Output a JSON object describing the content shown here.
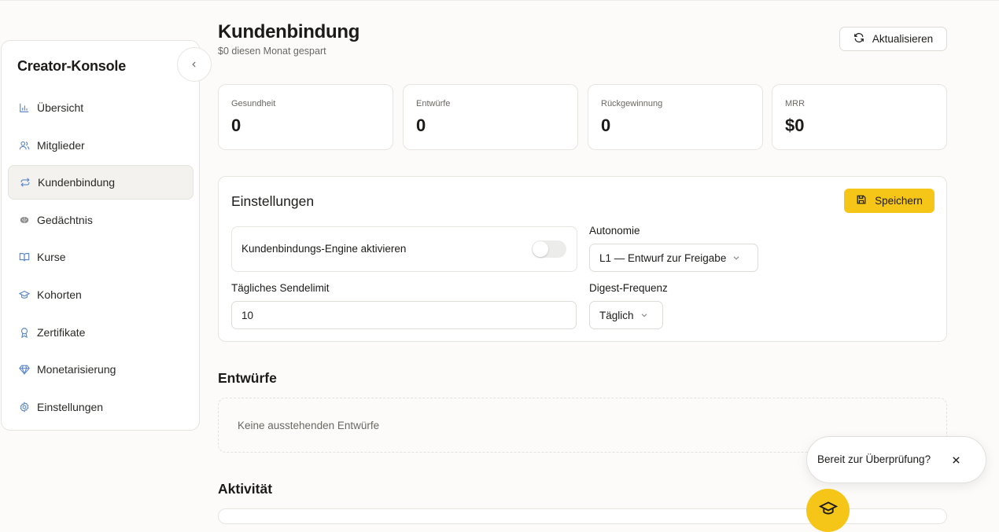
{
  "sidebar": {
    "title": "Creator-Konsole",
    "items": [
      {
        "label": "Übersicht",
        "icon": "bar-chart-icon"
      },
      {
        "label": "Mitglieder",
        "icon": "users-icon"
      },
      {
        "label": "Kundenbindung",
        "icon": "repeat-icon",
        "active": true
      },
      {
        "label": "Gedächtnis",
        "icon": "brain-icon"
      },
      {
        "label": "Kurse",
        "icon": "book-open-icon"
      },
      {
        "label": "Kohorten",
        "icon": "graduation-cap-icon"
      },
      {
        "label": "Zertifikate",
        "icon": "award-icon"
      },
      {
        "label": "Monetarisierung",
        "icon": "gem-icon"
      },
      {
        "label": "Einstellungen",
        "icon": "settings-icon"
      }
    ]
  },
  "header": {
    "title": "Kundenbindung",
    "subtitle": "$0 diesen Monat gespart",
    "refresh_label": "Aktualisieren"
  },
  "stats": [
    {
      "label": "Gesundheit",
      "value": "0"
    },
    {
      "label": "Entwürfe",
      "value": "0"
    },
    {
      "label": "Rückgewinnung",
      "value": "0"
    },
    {
      "label": "MRR",
      "value": "$0"
    }
  ],
  "settings": {
    "title": "Einstellungen",
    "save_label": "Speichern",
    "engine_label": "Kundenbindungs-Engine aktivieren",
    "engine_enabled": false,
    "autonomy_label": "Autonomie",
    "autonomy_value": "L1 — Entwurf zur Freigabe",
    "daily_limit_label": "Tägliches Sendelimit",
    "daily_limit_value": "10",
    "digest_label": "Digest-Frequenz",
    "digest_value": "Täglich"
  },
  "drafts": {
    "title": "Entwürfe",
    "empty_text": "Keine ausstehenden Entwürfe"
  },
  "activity": {
    "title": "Aktivität"
  },
  "toast": {
    "text": "Bereit zur Überprüfung?"
  },
  "colors": {
    "accent": "#f5c518",
    "background": "#fcfbf9",
    "border": "#e7e5e0",
    "muted_text": "#6a6863"
  }
}
